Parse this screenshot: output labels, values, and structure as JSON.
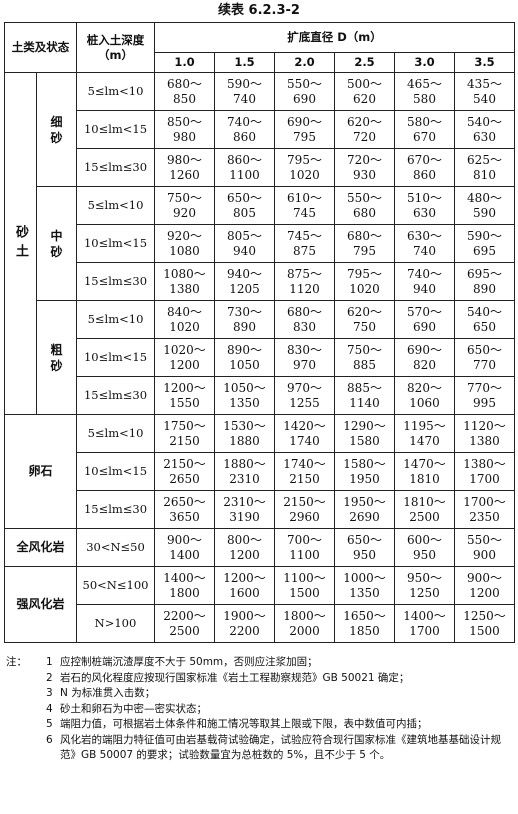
{
  "title": "续表 6.2.3-2",
  "header": {
    "soil": "土类及状态",
    "depth": "桩入土深度（m）",
    "diameter": "扩底直径 D（m）",
    "diameters": [
      "1.0",
      "1.5",
      "2.0",
      "2.5",
      "3.0",
      "3.5"
    ]
  },
  "groups": [
    {
      "label": "砂土",
      "subgroups": [
        {
          "label": "细砂",
          "rows": [
            {
              "depth": "5≤lm<10",
              "vals": [
                "680～850",
                "590～740",
                "550～690",
                "500～620",
                "465～580",
                "435～540"
              ]
            },
            {
              "depth": "10≤lm<15",
              "vals": [
                "850～980",
                "740～860",
                "690～795",
                "620～720",
                "580～670",
                "540～630"
              ]
            },
            {
              "depth": "15≤lm≤30",
              "vals": [
                "980～1260",
                "860～1100",
                "795～1020",
                "720～930",
                "670～860",
                "625～810"
              ]
            }
          ]
        },
        {
          "label": "中砂",
          "rows": [
            {
              "depth": "5≤lm<10",
              "vals": [
                "750～920",
                "650～805",
                "610～745",
                "550～680",
                "510～630",
                "480～590"
              ]
            },
            {
              "depth": "10≤lm<15",
              "vals": [
                "920～1080",
                "805～940",
                "745～875",
                "680～795",
                "630～740",
                "590～695"
              ]
            },
            {
              "depth": "15≤lm≤30",
              "vals": [
                "1080～1380",
                "940～1205",
                "875～1120",
                "795～1020",
                "740～940",
                "695～890"
              ]
            }
          ]
        },
        {
          "label": "粗砂",
          "rows": [
            {
              "depth": "5≤lm<10",
              "vals": [
                "840～1020",
                "730～890",
                "680～830",
                "620～750",
                "570～690",
                "540～650"
              ]
            },
            {
              "depth": "10≤lm<15",
              "vals": [
                "1020～1200",
                "890～1050",
                "830～970",
                "750～885",
                "690～820",
                "650～770"
              ]
            },
            {
              "depth": "15≤lm≤30",
              "vals": [
                "1200～1550",
                "1050～1350",
                "970～1255",
                "885～1140",
                "820～1060",
                "770～995"
              ]
            }
          ]
        }
      ]
    },
    {
      "label": "卵石",
      "rows": [
        {
          "depth": "5≤lm<10",
          "vals": [
            "1750～2150",
            "1530～1880",
            "1420～1740",
            "1290～1580",
            "1195～1470",
            "1120～1380"
          ]
        },
        {
          "depth": "10≤lm<15",
          "vals": [
            "2150～2650",
            "1880～2310",
            "1740～2150",
            "1580～1950",
            "1470～1810",
            "1380～1700"
          ]
        },
        {
          "depth": "15≤lm≤30",
          "vals": [
            "2650～3650",
            "2310～3190",
            "2150～2960",
            "1950～2690",
            "1810～2500",
            "1700～2350"
          ]
        }
      ]
    },
    {
      "label": "全风化岩",
      "rows": [
        {
          "depth": "30<N≤50",
          "vals": [
            "900～1400",
            "800～1200",
            "700～1100",
            "650～950",
            "600～950",
            "550～900"
          ]
        }
      ]
    },
    {
      "label": "强风化岩",
      "rows": [
        {
          "depth": "50<N≤100",
          "vals": [
            "1400～1800",
            "1200～1600",
            "1100～1500",
            "1000～1350",
            "950～1250",
            "900～1200"
          ]
        },
        {
          "depth": "N>100",
          "vals": [
            "2200～2500",
            "1900～2200",
            "1800～2000",
            "1650～1850",
            "1400～1700",
            "1250～1500"
          ]
        }
      ]
    }
  ],
  "notes": {
    "lead": "注：",
    "items": [
      {
        "num": "1",
        "text": "应控制桩端沉渣厚度不大于 50mm，否则应注浆加固；"
      },
      {
        "num": "2",
        "text": "岩石的风化程度应按现行国家标准《岩土工程勘察规范》GB 50021 确定；"
      },
      {
        "num": "3",
        "text": "N 为标准贯入击数；"
      },
      {
        "num": "4",
        "text": "砂土和卵石为中密—密实状态；"
      },
      {
        "num": "5",
        "text": "端阻力值，可根据岩土体条件和施工情况等取其上限或下限，表中数值可内插；"
      },
      {
        "num": "6",
        "text": "风化岩的端阻力特征值可由岩基载荷试验确定，试验应符合现行国家标准《建筑地基基础设计规范》GB 50007 的要求；试验数量宜为总桩数的 5%，且不少于 5 个。"
      }
    ]
  }
}
